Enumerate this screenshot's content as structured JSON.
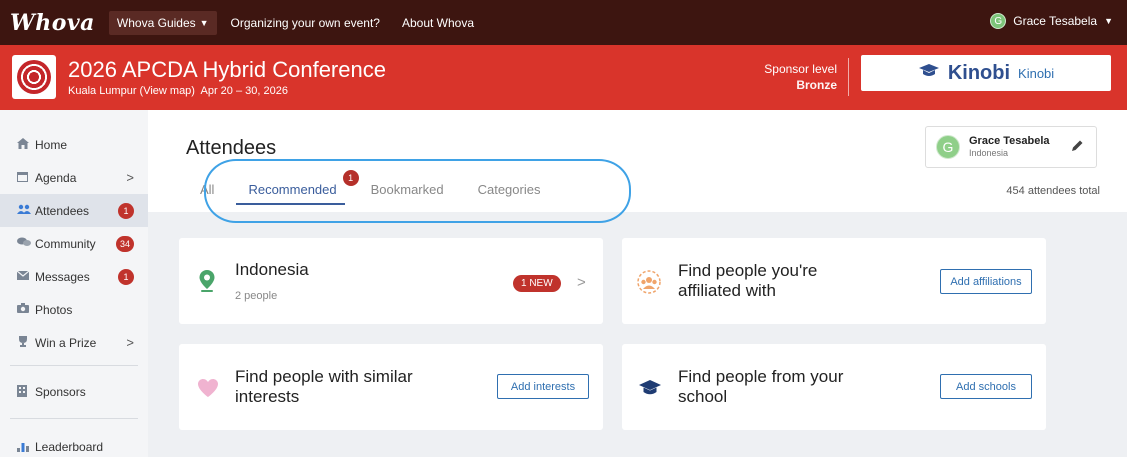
{
  "topnav": {
    "logo": "Whova",
    "guides_label": "Whova Guides",
    "links": [
      "Organizing your own event?",
      "About Whova"
    ],
    "user_initial": "G",
    "user_name": "Grace Tesabela"
  },
  "banner": {
    "title": "2026 APCDA Hybrid Conference",
    "location": "Kuala Lumpur (View map)",
    "dates": "Apr 20 – 30, 2026",
    "sponsor_label": "Sponsor level",
    "sponsor_level": "Bronze",
    "sponsor_logo_text": "Kinobi",
    "sponsor_name": "Kinobi"
  },
  "sidebar": {
    "items": [
      {
        "label": "Home",
        "icon": "home-icon"
      },
      {
        "label": "Agenda",
        "icon": "calendar-icon"
      },
      {
        "label": "Attendees",
        "icon": "people-icon",
        "badge": "1"
      },
      {
        "label": "Community",
        "icon": "chat-icon",
        "badge": "34"
      },
      {
        "label": "Messages",
        "icon": "mail-icon",
        "badge": "1"
      },
      {
        "label": "Photos",
        "icon": "camera-icon"
      },
      {
        "label": "Win a Prize",
        "icon": "trophy-icon"
      },
      {
        "label": "Sponsors",
        "icon": "building-icon"
      },
      {
        "label": "Leaderboard",
        "icon": "bar-chart-icon"
      }
    ]
  },
  "main": {
    "title": "Attendees",
    "tabs": [
      {
        "label": "All"
      },
      {
        "label": "Recommended",
        "badge": "1"
      },
      {
        "label": "Bookmarked"
      },
      {
        "label": "Categories"
      }
    ],
    "user_card": {
      "initial": "G",
      "name": "Grace Tesabela",
      "country": "Indonesia"
    },
    "total": "454 attendees total"
  },
  "cards": {
    "location": {
      "title": "Indonesia",
      "sub": "2 people",
      "badge": "1 NEW"
    },
    "affiliations": {
      "title": "Find people you're affiliated with",
      "button": "Add affiliations"
    },
    "interests": {
      "title": "Find people with similar interests",
      "button": "Add interests"
    },
    "schools": {
      "title": "Find people from your school",
      "button": "Add schools"
    }
  },
  "colors": {
    "topnav": "#3d1510",
    "banner": "#d9342b",
    "accent_blue": "#3a5d9c",
    "badge_red": "#c0332c",
    "annotation": "#3fa2e6"
  }
}
